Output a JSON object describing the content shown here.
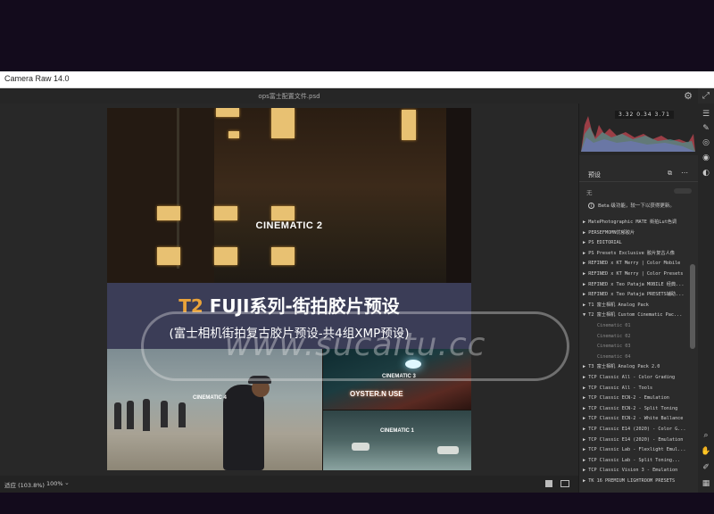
{
  "window": {
    "title": "Camera Raw 14.0"
  },
  "document": {
    "filename": "ops富士配置文件.psd"
  },
  "status": {
    "fit": "适应 (103.8%)",
    "zoom": "100%"
  },
  "image": {
    "cinematic_main": "CINEMATIC 2",
    "headline_prefix": "T2",
    "headline_rest": " FUJI系列-街拍胶片预设",
    "subline": "(富士相机街拍复古胶片预设-共4组XMP预设)",
    "thumb_labels": [
      "CINEMATIC 4",
      "CINEMATIC 3",
      "CINEMATIC 1"
    ],
    "sign_text": "OYSTER.N USE",
    "watermark": "www.sucaitu.cc"
  },
  "histogram": {
    "readout": "3.32  0.34  3.71"
  },
  "presets": {
    "heading": "预设",
    "amount_label": "无",
    "note": "Beta 级功能，较一下以获得更新。",
    "items": [
      {
        "label": "▶ MatePhotographic MATE 街拍Lut色调",
        "sub": false
      },
      {
        "label": "▶ PERSEFMOMN忧郁胶片",
        "sub": false
      },
      {
        "label": "▶ PS EDITORIAL",
        "sub": false
      },
      {
        "label": "▶ PS Presets Exclusive  胶片复古人像",
        "sub": false
      },
      {
        "label": "▶ REFINED x KT Merry | Color Mobile",
        "sub": false
      },
      {
        "label": "▶ REFINED x KT Merry | Color Presets",
        "sub": false
      },
      {
        "label": "▶ REFINED x Teo Pataja MOBILE 经典...",
        "sub": false
      },
      {
        "label": "▶ REFINED x Teo Pataja PRESETS辅助...",
        "sub": false
      },
      {
        "label": "▶ T1 富士相机 Analog Pack",
        "sub": false
      },
      {
        "label": "▼ T2 富士相机 Custom Cinematic Pac...",
        "sub": false
      },
      {
        "label": "Cinematic 01",
        "sub": true
      },
      {
        "label": "Cinematic 02",
        "sub": true
      },
      {
        "label": "Cinematic 03",
        "sub": true
      },
      {
        "label": "Cinematic 04",
        "sub": true
      },
      {
        "label": "▶ T3 富士相机 Analog Pack 2.0",
        "sub": false
      },
      {
        "label": "▶ TCP Classic All - Color Grading",
        "sub": false
      },
      {
        "label": "▶ TCP Classic All - Tools",
        "sub": false
      },
      {
        "label": "▶ TCP Classic ECN-2 - Emulation",
        "sub": false
      },
      {
        "label": "▶ TCP Classic ECN-2 - Split Toning",
        "sub": false
      },
      {
        "label": "▶ TCP Classic ECN-2 - White Ballance",
        "sub": false
      },
      {
        "label": "▶ TCP Classic E14 (2020) - Color G...",
        "sub": false
      },
      {
        "label": "▶ TCP Classic E14 (2020) - Emulation",
        "sub": false
      },
      {
        "label": "▶ TCP Classic Lab - Flexlight Emul...",
        "sub": false
      },
      {
        "label": "▶ TCP Classic Lab - Split Toning...",
        "sub": false
      },
      {
        "label": "▶ TCP Classic Vision 3 - Emulation",
        "sub": false
      },
      {
        "label": "▶ TK 16 PREMIUM LIGHTROOM PRESETS",
        "sub": false
      }
    ]
  },
  "icons": {
    "gear": "gear-icon",
    "expand": "expand-icon",
    "tools": [
      "sliders-icon",
      "brush-icon",
      "heal-icon",
      "redeye-icon",
      "mask-icon",
      "presets-icon",
      "zoom-icon",
      "hand-icon",
      "eyedropper-icon",
      "grid-icon"
    ]
  },
  "colors": {
    "accent": "#e9a33a",
    "banner": "#3b3d57",
    "app_bg": "#2a2a2a"
  }
}
